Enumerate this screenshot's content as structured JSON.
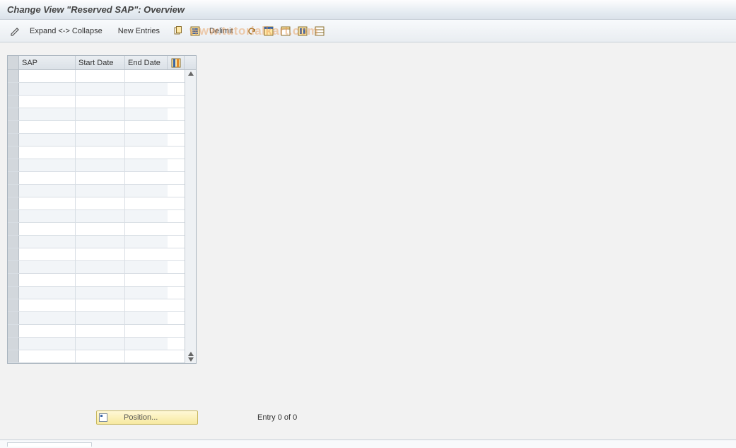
{
  "title": "Change View \"Reserved SAP\": Overview",
  "toolbar": {
    "expand_collapse_label": "Expand <-> Collapse",
    "new_entries_label": "New Entries",
    "delimit_label": "Delimit"
  },
  "watermark_text": "www.tutorialkart.com",
  "grid": {
    "columns": {
      "sap": "SAP",
      "start_date": "Start Date",
      "end_date": "End Date"
    },
    "rows": [
      {
        "sap": "",
        "start": "",
        "end": ""
      },
      {
        "sap": "",
        "start": "",
        "end": ""
      },
      {
        "sap": "",
        "start": "",
        "end": ""
      },
      {
        "sap": "",
        "start": "",
        "end": ""
      },
      {
        "sap": "",
        "start": "",
        "end": ""
      },
      {
        "sap": "",
        "start": "",
        "end": ""
      },
      {
        "sap": "",
        "start": "",
        "end": ""
      },
      {
        "sap": "",
        "start": "",
        "end": ""
      },
      {
        "sap": "",
        "start": "",
        "end": ""
      },
      {
        "sap": "",
        "start": "",
        "end": ""
      },
      {
        "sap": "",
        "start": "",
        "end": ""
      },
      {
        "sap": "",
        "start": "",
        "end": ""
      },
      {
        "sap": "",
        "start": "",
        "end": ""
      },
      {
        "sap": "",
        "start": "",
        "end": ""
      },
      {
        "sap": "",
        "start": "",
        "end": ""
      },
      {
        "sap": "",
        "start": "",
        "end": ""
      },
      {
        "sap": "",
        "start": "",
        "end": ""
      },
      {
        "sap": "",
        "start": "",
        "end": ""
      },
      {
        "sap": "",
        "start": "",
        "end": ""
      },
      {
        "sap": "",
        "start": "",
        "end": ""
      },
      {
        "sap": "",
        "start": "",
        "end": ""
      },
      {
        "sap": "",
        "start": "",
        "end": ""
      },
      {
        "sap": "",
        "start": "",
        "end": ""
      }
    ]
  },
  "footer": {
    "position_label": "Position...",
    "entry_text": "Entry 0 of 0"
  }
}
